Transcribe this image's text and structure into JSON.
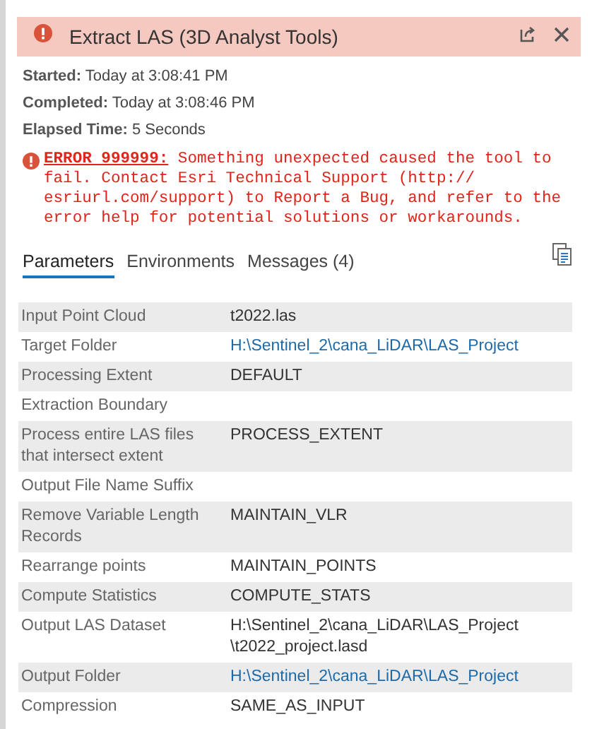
{
  "window": {
    "title": "Extract LAS (3D Analyst Tools)"
  },
  "info": [
    {
      "label": "Started:",
      "value": "Today at 3:08:41 PM"
    },
    {
      "label": "Completed:",
      "value": "Today at 3:08:46 PM"
    },
    {
      "label": "Elapsed Time:",
      "value": "5 Seconds"
    }
  ],
  "error": {
    "code": "ERROR 999999:",
    "message": " Something unexpected caused the tool to\nfail. Contact Esri Technical Support (http://\nesriurl.com/support) to Report a Bug, and refer to the\nerror help for potential solutions or workarounds."
  },
  "tabs": [
    {
      "label": "Parameters",
      "selected": true
    },
    {
      "label": "Environments",
      "selected": false
    },
    {
      "label": "Messages (4)",
      "selected": false
    }
  ],
  "rows": [
    {
      "label": "Input Point Cloud",
      "value": "t2022.las",
      "link": false
    },
    {
      "label": "Target Folder",
      "value": "H:\\Sentinel_2\\cana_LiDAR\\LAS_Project",
      "link": true
    },
    {
      "label": "Processing Extent",
      "value": "DEFAULT",
      "link": false
    },
    {
      "label": "Extraction Boundary"
    },
    {
      "label": "Process entire LAS files that intersect extent",
      "value": "PROCESS_EXTENT",
      "link": false
    },
    {
      "label": "Output File Name Suffix"
    },
    {
      "label": "Remove Variable Length Records",
      "value": "MAINTAIN_VLR",
      "link": false
    },
    {
      "label": "Rearrange points",
      "value": "MAINTAIN_POINTS",
      "link": false
    },
    {
      "label": "Compute Statistics",
      "value": "COMPUTE_STATS",
      "link": false
    },
    {
      "label": "Output LAS Dataset",
      "value": "H:\\Sentinel_2\\cana_LiDAR\\LAS_Project\n\\t2022_project.lasd",
      "link": false
    },
    {
      "label": "Output Folder",
      "value": "H:\\Sentinel_2\\cana_LiDAR\\LAS_Project",
      "link": true
    },
    {
      "label": "Compression",
      "value": "SAME_AS_INPUT",
      "link": false
    }
  ]
}
